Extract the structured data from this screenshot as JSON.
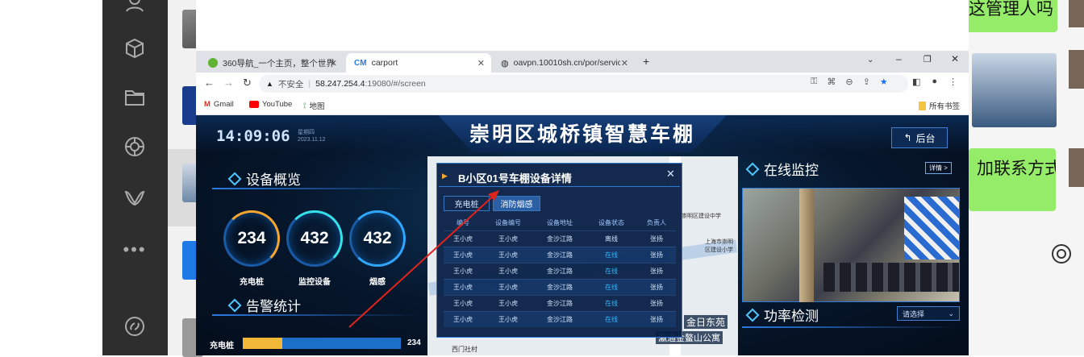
{
  "chat_right": {
    "bubble1": "这管理人吗",
    "bubble2": "加联系方式"
  },
  "browser": {
    "tabs": [
      {
        "label": "360导航_一个主页，整个世界",
        "active": false
      },
      {
        "label": "carport",
        "active": true
      },
      {
        "label": "oavpn.10010sh.cn/por/service",
        "active": false
      }
    ],
    "address": {
      "insecure_label": "不安全",
      "url_host": "58.247.254.4",
      "url_rest": ":19080/#/screen"
    },
    "bookmarks": [
      "Gmail",
      "YouTube",
      "地图"
    ],
    "all_bookmarks": "所有书签"
  },
  "dashboard": {
    "time": "14:09:06",
    "weekday": "星期四",
    "date": "2023.11.12",
    "title": "崇明区城桥镇智慧车棚",
    "back_label": "后台",
    "overview": {
      "title": "设备概览",
      "stats": [
        {
          "value": "234",
          "label": "充电桩",
          "fill": 0.3
        },
        {
          "value": "432",
          "label": "监控设备",
          "fill": 0.55
        },
        {
          "value": "432",
          "label": "烟感",
          "fill": 0.75
        }
      ]
    },
    "alarm": {
      "title": "告警统计",
      "row_label": "充电桩",
      "row_value": "234"
    },
    "monitor": {
      "title": "在线监控",
      "detail_label": "详情 >"
    },
    "power": {
      "title": "功率检测",
      "select_placeholder": "请选择"
    },
    "map_labels": {
      "school1": "崇明区建设中学",
      "school2": "上海市崇明区建设小学",
      "apt": "瀛通金鳌山公寓",
      "area": "金日东苑",
      "village": "西门社村"
    },
    "modal": {
      "title": "B小区01号车棚设备详情",
      "tabs": [
        "充电桩",
        "消防烟感"
      ],
      "active_tab": 1,
      "columns": [
        "编号",
        "设备编号",
        "设备地址",
        "设备状态",
        "负责人"
      ],
      "rows": [
        [
          "王小虎",
          "王小虎",
          "金沙江路",
          "离线",
          "张扬"
        ],
        [
          "王小虎",
          "王小虎",
          "金沙江路",
          "在线",
          "张扬"
        ],
        [
          "王小虎",
          "王小虎",
          "金沙江路",
          "在线",
          "张扬"
        ],
        [
          "王小虎",
          "王小虎",
          "金沙江路",
          "在线",
          "张扬"
        ],
        [
          "王小虎",
          "王小虎",
          "金沙江路",
          "在线",
          "张扬"
        ],
        [
          "王小虎",
          "王小虎",
          "金沙江路",
          "在线",
          "张扬"
        ]
      ]
    }
  },
  "colors": {
    "accent": "#4fc6ff",
    "online": "#2fb7ff",
    "offline": "#cfe0f5",
    "bubble": "#95ec69"
  }
}
